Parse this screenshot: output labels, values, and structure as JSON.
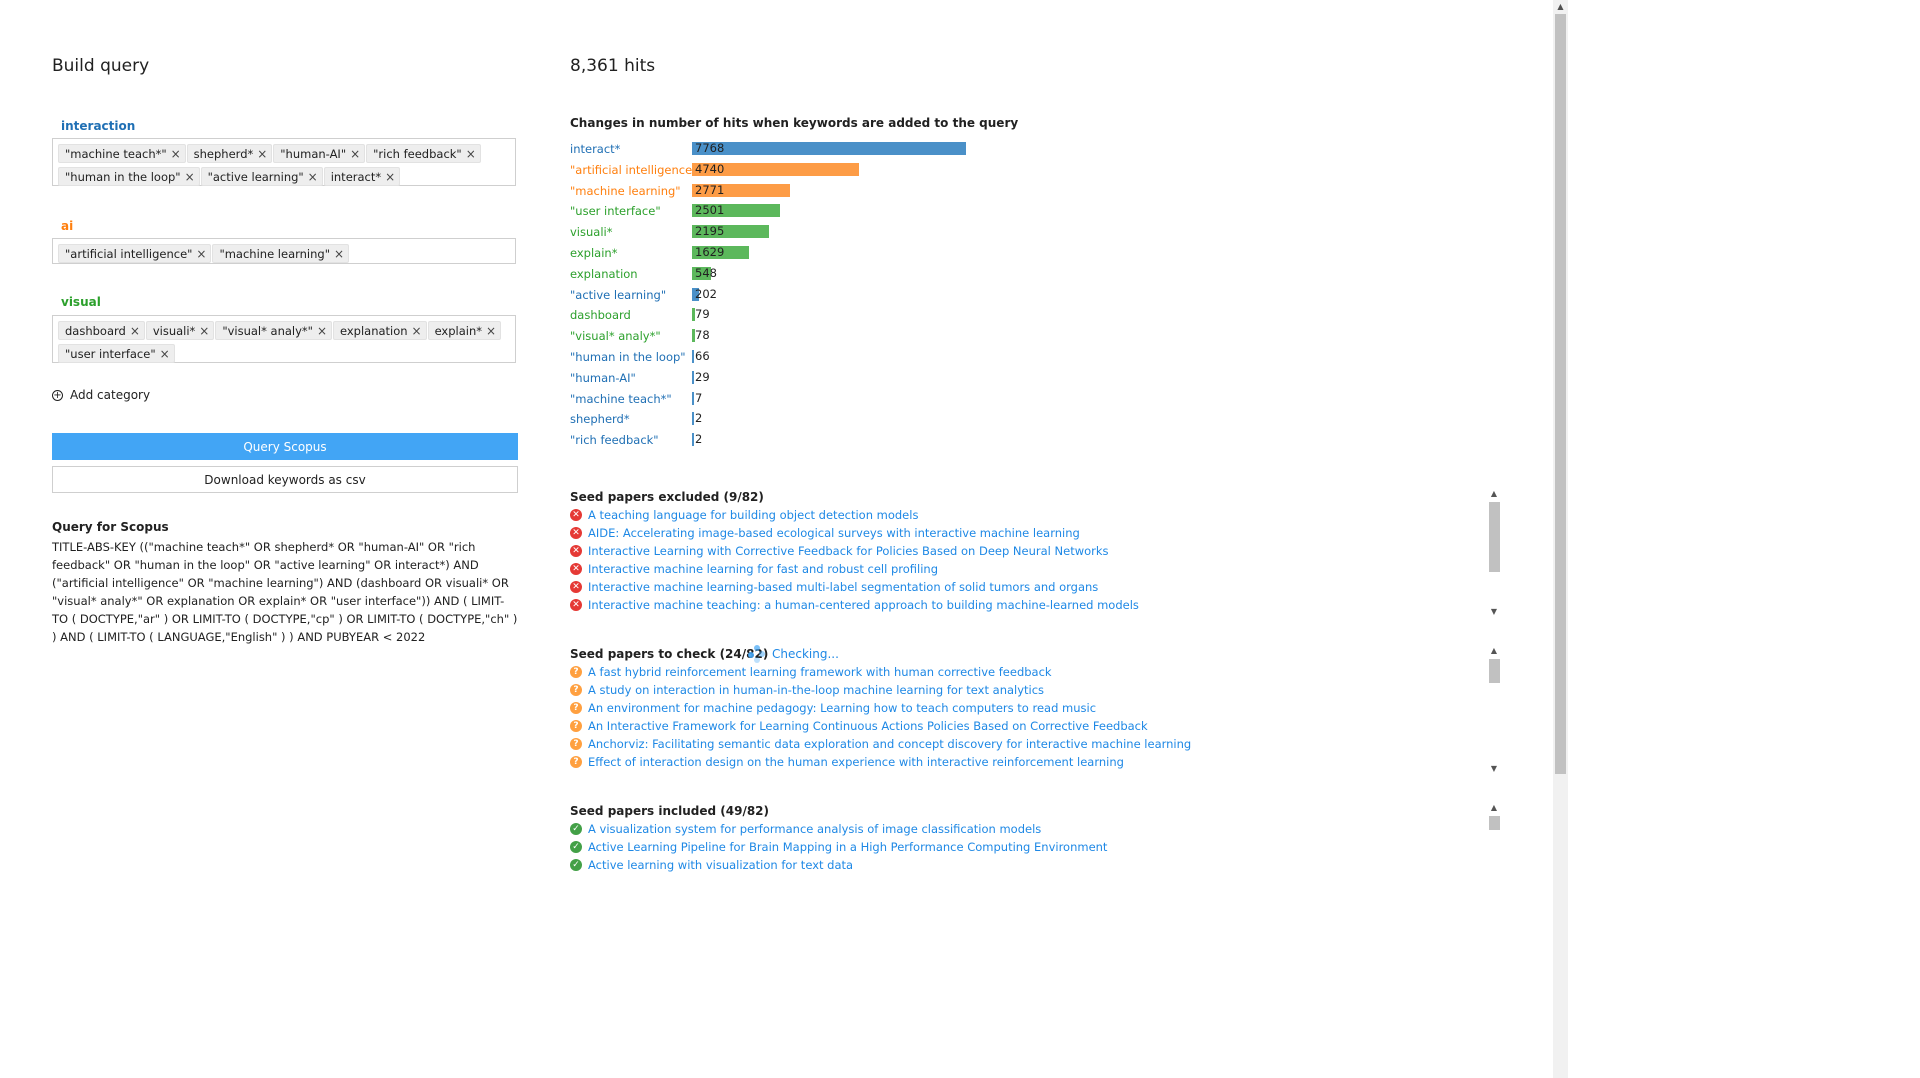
{
  "left": {
    "title": "Build query",
    "categories": [
      {
        "name": "interaction",
        "color": "#1f6fb4",
        "tags": [
          "\"machine teach*\"",
          "shepherd*",
          "\"human-AI\"",
          "\"rich feedback\"",
          "\"human in the loop\"",
          "\"active learning\"",
          "interact*"
        ]
      },
      {
        "name": "ai",
        "color": "#ff7f0e",
        "tags": [
          "\"artificial intelligence\"",
          "\"machine learning\""
        ]
      },
      {
        "name": "visual",
        "color": "#2ca02c",
        "tags": [
          "dashboard",
          "visuali*",
          "\"visual* analy*\"",
          "explanation",
          "explain*",
          "\"user interface\""
        ]
      }
    ],
    "tag_remove_glyph": "×",
    "add_category": "Add category",
    "add_category_glyph": "+",
    "query_button": "Query Scopus",
    "download_button": "Download keywords as csv",
    "query_heading": "Query for Scopus",
    "query_text": "TITLE-ABS-KEY ((\"machine teach*\" OR shepherd* OR \"human-AI\" OR \"rich feedback\" OR \"human in the loop\" OR \"active learning\" OR interact*) AND (\"artificial intelligence\" OR \"machine learning\") AND (dashboard OR visuali* OR \"visual* analy*\" OR explanation OR explain* OR \"user interface\")) AND ( LIMIT-TO ( DOCTYPE,\"ar\" ) OR LIMIT-TO ( DOCTYPE,\"cp\" ) OR LIMIT-TO ( DOCTYPE,\"ch\" ) ) AND ( LIMIT-TO ( LANGUAGE,\"English\" ) ) AND PUBYEAR < 2022"
  },
  "right": {
    "hits": "8,361 hits",
    "chart_title": "Changes in number of hits when keywords are added to the query",
    "seed_excluded": {
      "heading": "Seed papers excluded (9/82)",
      "icon": "x-circle-icon",
      "papers": [
        "A teaching language for building object detection models",
        "AIDE: Accelerating image-based ecological surveys with interactive machine learning",
        "Interactive Learning with Corrective Feedback for Policies Based on Deep Neural Networks",
        "Interactive machine learning for fast and robust cell profiling",
        "Interactive machine learning-based multi-label segmentation of solid tumors and organs",
        "Interactive machine teaching: a human-centered approach to building machine-learned models"
      ]
    },
    "seed_check": {
      "heading": "Seed papers to check (24/82)",
      "status": "Checking...",
      "icon": "question-circle-icon",
      "papers": [
        "A fast hybrid reinforcement learning framework with human corrective feedback",
        "A study on interaction in human-in-the-loop machine learning for text analytics",
        "An environment for machine pedagogy: Learning how to teach computers to read music",
        "An Interactive Framework for Learning Continuous Actions Policies Based on Corrective Feedback",
        "Anchorviz: Facilitating semantic data exploration and concept discovery for interactive machine learning",
        "Effect of interaction design on the human experience with interactive reinforcement learning"
      ]
    },
    "seed_included": {
      "heading": "Seed papers included (49/82)",
      "icon": "check-circle-icon",
      "papers": [
        "A visualization system for performance analysis of image classification models",
        "Active Learning Pipeline for Brain Mapping in a High Performance Computing Environment",
        "Active learning with visualization for text data"
      ]
    },
    "glyphs": {
      "excluded": "✕",
      "check": "?",
      "included": "✓",
      "scroll_up": "▲",
      "scroll_down": "▼"
    }
  },
  "colors": {
    "interaction": "#1f6fb4",
    "ai": "#ff7f0e",
    "visual": "#2ca02c",
    "bar_interaction": "#4a90c8",
    "bar_ai": "#fd9c46",
    "bar_visual": "#5cb85c",
    "primary_button": "#42a5f5",
    "link": "#1e88e5"
  },
  "chart_data": {
    "type": "bar",
    "orientation": "horizontal",
    "title": "Changes in number of hits when keywords are added to the query",
    "categories": [
      "interact*",
      "\"artificial intelligence\"",
      "\"machine learning\"",
      "\"user interface\"",
      "visuali*",
      "explain*",
      "explanation",
      "\"active learning\"",
      "dashboard",
      "\"visual* analy*\"",
      "\"human in the loop\"",
      "\"human-AI\"",
      "\"machine teach*\"",
      "shepherd*",
      "\"rich feedback\""
    ],
    "values": [
      7768,
      4740,
      2771,
      2501,
      2195,
      1629,
      548,
      202,
      79,
      78,
      66,
      29,
      7,
      2,
      2
    ],
    "group": [
      "interaction",
      "ai",
      "ai",
      "visual",
      "visual",
      "visual",
      "visual",
      "interaction",
      "visual",
      "visual",
      "interaction",
      "interaction",
      "interaction",
      "interaction",
      "interaction"
    ],
    "xlim": [
      0,
      7768
    ],
    "grid": false,
    "legend": "none"
  }
}
